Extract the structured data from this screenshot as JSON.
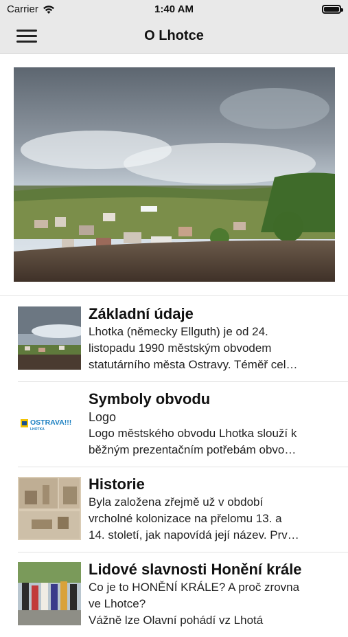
{
  "status": {
    "carrier": "Carrier",
    "time": "1:40 AM"
  },
  "nav": {
    "title": "O Lhotce"
  },
  "items": [
    {
      "title": "Základní údaje",
      "subtitle": "",
      "description": "Lhotka (německy Ellguth) je od 24.\nlistopadu 1990 městským obvodem\nstatutárního města Ostravy. Téměř cel…"
    },
    {
      "title": "Symboly obvodu",
      "subtitle": "Logo",
      "description": "Logo městského obvodu Lhotka slouží k\nběžným prezentačním potřebám obvo…",
      "thumb_logo": "OSTRAVA!!!",
      "thumb_logo_sub": "LHOTKA"
    },
    {
      "title": "Historie",
      "subtitle": "",
      "description": "Byla založena zřejmě už v období\nvrcholné kolonizace na přelomu 13. a\n14. století, jak napovídá její název. Prv…"
    },
    {
      "title": "Lidové slavnosti Honění krále",
      "subtitle": "",
      "description": "Co je to HONĚNÍ KRÁLE? A proč zrovna\nve Lhotce?\nVážně lze Olavní pohádí vz Lhotá"
    }
  ],
  "colors": {
    "bar": "#e9e9e9",
    "accent_logo": "#1a7fc1",
    "logo_yellow": "#f2c200"
  }
}
